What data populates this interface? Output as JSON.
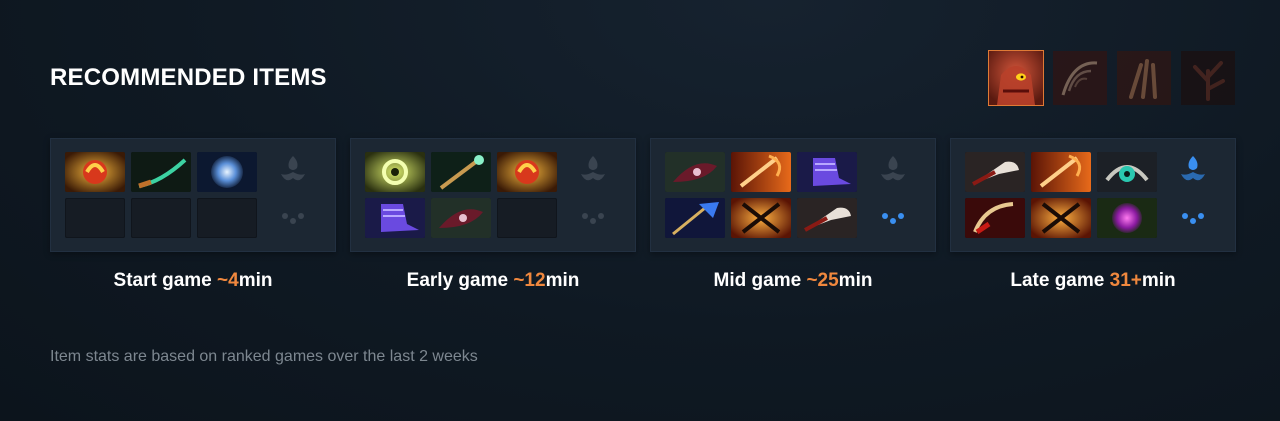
{
  "header": {
    "title": "RECOMMENDED ITEMS"
  },
  "facets": [
    {
      "name": "hero-portrait",
      "selected": true
    },
    {
      "name": "ribcage-icon",
      "selected": false
    },
    {
      "name": "claw-icon",
      "selected": false
    },
    {
      "name": "tree-icon",
      "selected": false
    }
  ],
  "stages": [
    {
      "label_prefix": "Start game ",
      "label_time": "~4",
      "label_suffix": "min",
      "items": [
        "faerie-fire",
        "magic-stick",
        "orb-of-frost",
        "",
        "",
        ""
      ],
      "neutral_tier_active": false
    },
    {
      "label_prefix": "Early game ",
      "label_time": "~12",
      "label_suffix": "min",
      "items": [
        "ring-of-basilius",
        "magic-wand",
        "faerie-fire",
        "boots-of-travel",
        "blight-stone",
        ""
      ],
      "neutral_tier_active": false
    },
    {
      "label_prefix": "Mid game ",
      "label_time": "~25",
      "label_suffix": "min",
      "items": [
        "blight-stone",
        "battle-fury",
        "boots-of-travel",
        "dagon",
        "crossed-swords",
        "skull-basher"
      ],
      "neutral_tier_active": true
    },
    {
      "label_prefix": "Late game ",
      "label_time": "31+",
      "label_suffix": "min",
      "items": [
        "skull-basher",
        "battle-fury",
        "eye-of-skadi",
        "sange",
        "crossed-swords",
        "octarine-core"
      ],
      "neutral_tier_active": true
    }
  ],
  "footer": {
    "note": "Item stats are based on ranked games over the last 2 weeks"
  },
  "colors": {
    "accent": "#f0883e",
    "panel": "#1c2733",
    "background": "#0f1923",
    "neutral_active": "#3a8ff0"
  }
}
